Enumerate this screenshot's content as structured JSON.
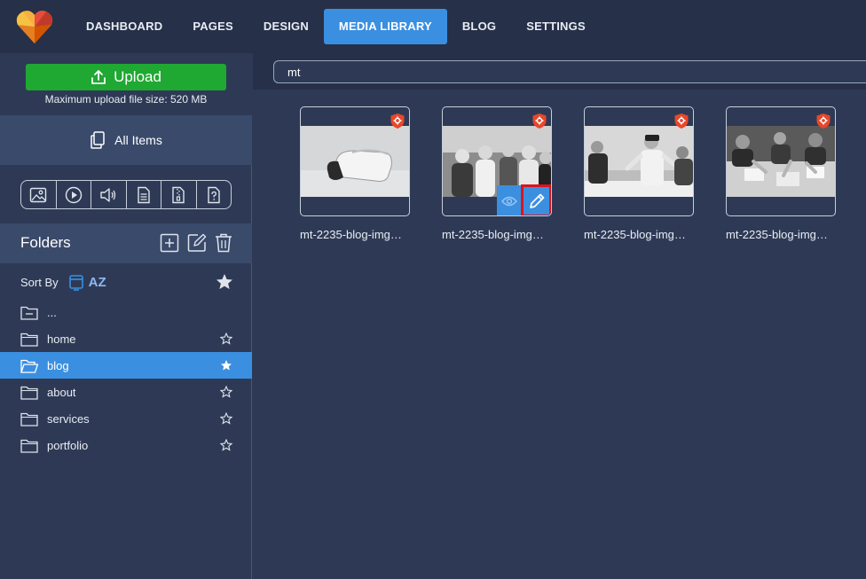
{
  "nav": {
    "items": [
      {
        "label": "DASHBOARD",
        "active": false
      },
      {
        "label": "PAGES",
        "active": false
      },
      {
        "label": "DESIGN",
        "active": false
      },
      {
        "label": "MEDIA LIBRARY",
        "active": true
      },
      {
        "label": "BLOG",
        "active": false
      },
      {
        "label": "SETTINGS",
        "active": false
      }
    ]
  },
  "sidebar": {
    "upload_label": "Upload",
    "upload_note": "Maximum upload file size: 520 MB",
    "all_items_label": "All Items",
    "filters": [
      "image-filter-icon",
      "video-filter-icon",
      "audio-filter-icon",
      "document-filter-icon",
      "archive-filter-icon",
      "unknown-filter-icon"
    ],
    "folders_title": "Folders",
    "sort_by_label": "Sort By",
    "sort_mode": "AZ",
    "folders": [
      {
        "name": "...",
        "starred": null,
        "active": false
      },
      {
        "name": "home",
        "starred": false,
        "active": false
      },
      {
        "name": "blog",
        "starred": true,
        "active": true
      },
      {
        "name": "about",
        "starred": false,
        "active": false
      },
      {
        "name": "services",
        "starred": false,
        "active": false
      },
      {
        "name": "portfolio",
        "starred": false,
        "active": false
      }
    ]
  },
  "main": {
    "search_value": "mt",
    "items": [
      {
        "label": "mt-2235-blog-img…"
      },
      {
        "label": "mt-2235-blog-img…"
      },
      {
        "label": "mt-2235-blog-img…"
      },
      {
        "label": "mt-2235-blog-img…"
      }
    ]
  },
  "colors": {
    "accent": "#3b8fe0",
    "upload_green": "#1fa832",
    "highlight_red": "#d9141e",
    "badge_orange": "#e8472b"
  }
}
